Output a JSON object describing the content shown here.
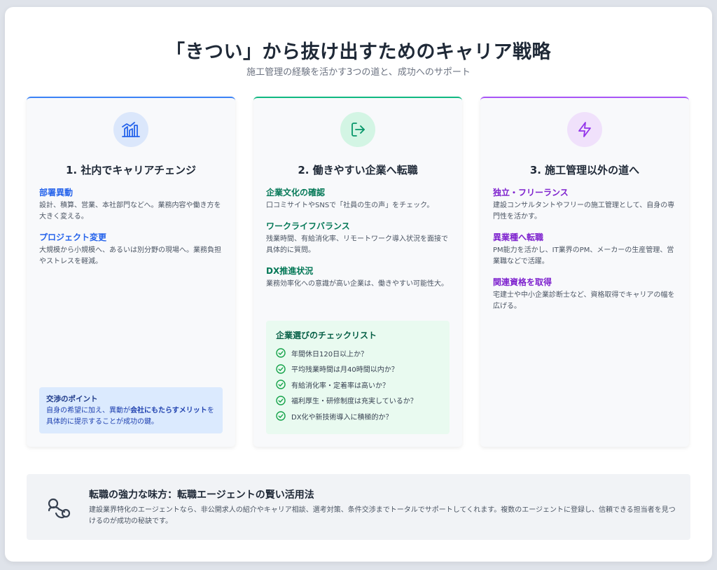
{
  "header": {
    "title": "「きつい」から抜け出すためのキャリア戦略",
    "subtitle": "施工管理の経験を活かす3つの道と、成功へのサポート"
  },
  "cards": [
    {
      "title": "1. 社内でキャリアチェンジ",
      "icon": "chart-icon",
      "accent": "#3b82f6",
      "items": [
        {
          "heading": "部署異動",
          "body": "設計、積算、営業、本社部門などへ。業務内容や働き方を大きく変える。"
        },
        {
          "heading": "プロジェクト変更",
          "body": "大規模から小規模へ、あるいは別分野の現場へ。業務負担やストレスを軽減。"
        }
      ],
      "tip": {
        "heading": "交渉のポイント",
        "body_pre": "自身の希望に加え、異動が",
        "body_bold": "会社にもたらすメリット",
        "body_post": "を具体的に提示することが成功の鍵。"
      }
    },
    {
      "title": "2. 働きやすい企業へ転職",
      "icon": "exit-icon",
      "accent": "#10b981",
      "items": [
        {
          "heading": "企業文化の確認",
          "body": "口コミサイトやSNSで「社員の生の声」をチェック。"
        },
        {
          "heading": "ワークライフバランス",
          "body": "残業時間、有給消化率、リモートワーク導入状況を面接で具体的に質問。"
        },
        {
          "heading": "DX推進状況",
          "body": "業務効率化への意識が高い企業は、働きやすい可能性大。"
        }
      ],
      "checklist": {
        "heading": "企業選びのチェックリスト",
        "items": [
          "年間休日120日以上か？",
          "平均残業時間は月40時間以内か？",
          "有給消化率・定着率は高いか？",
          "福利厚生・研修制度は充実しているか？",
          "DX化や新技術導入に積極的か？"
        ]
      }
    },
    {
      "title": "3. 施工管理以外の道へ",
      "icon": "lightning-icon",
      "accent": "#a855f7",
      "items": [
        {
          "heading": "独立・フリーランス",
          "body": "建設コンサルタントやフリーの施工管理として、自身の専門性を活かす。"
        },
        {
          "heading": "異業種へ転職",
          "body": "PM能力を活かし、IT業界のPM、メーカーの生産管理、営業職などで活躍。"
        },
        {
          "heading": "関連資格を取得",
          "body": "宅建士や中小企業診断士など、資格取得でキャリアの幅を広げる。"
        }
      ]
    }
  ],
  "agent": {
    "icon": "handshake-icon",
    "heading": "転職の強力な味方：転職エージェントの賢い活用法",
    "body": "建設業界特化のエージェントなら、非公開求人の紹介やキャリア相談、選考対策、条件交渉までトータルでサポートしてくれます。複数のエージェントに登録し、信頼できる担当者を見つけるのが成功の秘訣です。"
  }
}
